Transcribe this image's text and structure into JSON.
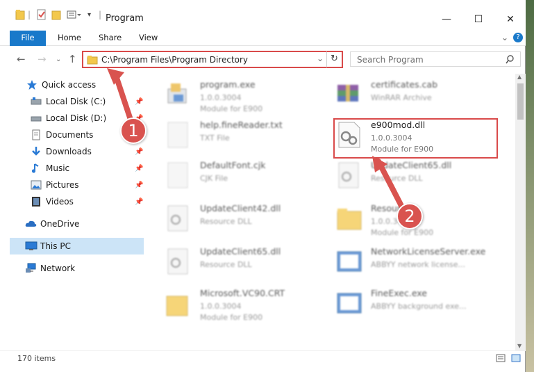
{
  "window": {
    "title": "Program",
    "tabs": [
      "File",
      "Home",
      "Share",
      "View"
    ],
    "controls": [
      "—",
      "☐",
      "✕"
    ],
    "help": "?"
  },
  "address": {
    "path": "C:\\Program Files\\Program Directory",
    "search_placeholder": "Search Program"
  },
  "sidebar": {
    "items": [
      {
        "label": "Quick access",
        "icon": "star-icon",
        "pinned": false
      },
      {
        "label": "Local Disk (C:)",
        "icon": "drive-icon",
        "pinned": true
      },
      {
        "label": "Local Disk (D:)",
        "icon": "drive-icon",
        "pinned": true
      },
      {
        "label": "Documents",
        "icon": "documents-icon",
        "pinned": false
      },
      {
        "label": "Downloads",
        "icon": "download-icon",
        "pinned": true
      },
      {
        "label": "Music",
        "icon": "music-icon",
        "pinned": true
      },
      {
        "label": "Pictures",
        "icon": "pictures-icon",
        "pinned": true
      },
      {
        "label": "Videos",
        "icon": "videos-icon",
        "pinned": true
      },
      {
        "label": "OneDrive",
        "icon": "cloud-icon",
        "pinned": false
      },
      {
        "label": "This PC",
        "icon": "pc-icon",
        "pinned": false,
        "selected": true
      },
      {
        "label": "Network",
        "icon": "network-icon",
        "pinned": false
      }
    ]
  },
  "files": [
    {
      "name": "program.exe",
      "line2": "1.0.0.3004",
      "line3": "Module for E900",
      "blur": true
    },
    {
      "name": "certificates.cab",
      "line2": "WinRAR Archive",
      "line3": "",
      "blur": true
    },
    {
      "name": "help.fineReader.txt",
      "line2": "TXT File",
      "line3": "",
      "blur": true
    },
    {
      "name": "e900mod.dll",
      "line2": "1.0.0.3004",
      "line3": "Module for E900",
      "blur": false
    },
    {
      "name": "DefaultFont.cjk",
      "line2": "CJK File",
      "line3": "",
      "blur": true
    },
    {
      "name": "UpdateClient65.dll",
      "line2": "Resource DLL",
      "line3": "",
      "blur": true
    },
    {
      "name": "UpdateClient42.dll",
      "line2": "Resource DLL",
      "line3": "",
      "blur": true
    },
    {
      "name": "Resources",
      "line2": "1.0.0.3004",
      "line3": "Module for E900",
      "blur": true
    },
    {
      "name": "UpdateClient65.dll",
      "line2": "Resource DLL",
      "line3": "",
      "blur": true
    },
    {
      "name": "NetworkLicenseServer.exe",
      "line2": "ABBYY network license...",
      "line3": "",
      "blur": true
    },
    {
      "name": "Microsoft.VC90.CRT",
      "line2": "1.0.0.3004",
      "line3": "Module for E900",
      "blur": true
    },
    {
      "name": "FineExec.exe",
      "line2": "ABBYY background exe...",
      "line3": "",
      "blur": true
    }
  ],
  "status": {
    "count": "170 items"
  },
  "annotations": [
    "1",
    "2"
  ],
  "colors": {
    "accent": "#1979ca",
    "highlight": "#d94a4a",
    "selected_bg": "#cce4f7"
  }
}
